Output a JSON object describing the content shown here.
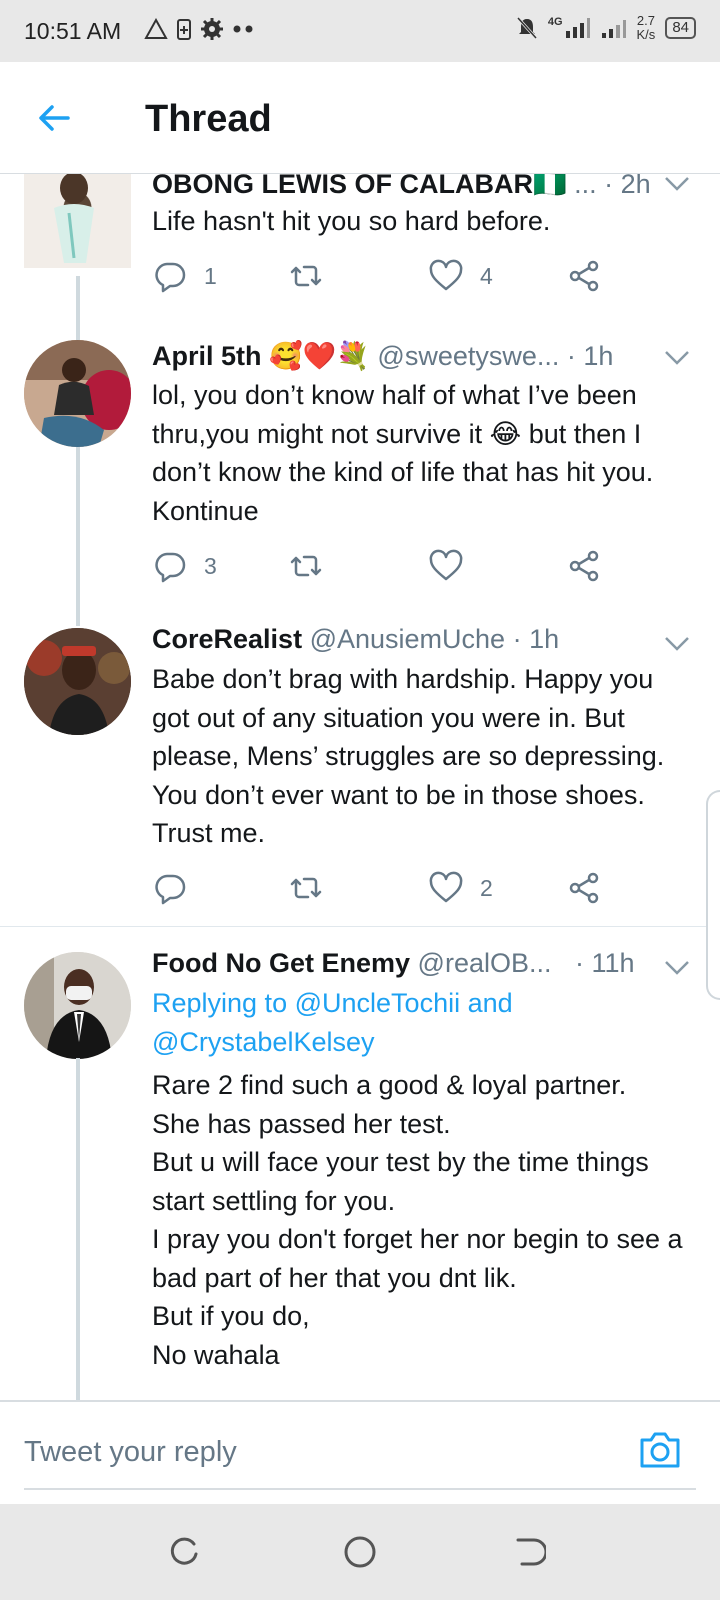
{
  "status_bar": {
    "time": "10:51 AM",
    "network": "4G",
    "speed_value": "2.7",
    "speed_unit": "K/s",
    "battery": "84",
    "icons": [
      "alert-triangle-icon",
      "battery-saver-icon",
      "settings-gear-icon",
      "more-dots-icon",
      "mute-bell-icon",
      "signal-icon",
      "signal-icon"
    ]
  },
  "header": {
    "title": "Thread",
    "back_icon": "back-arrow-icon"
  },
  "tweets": [
    {
      "name": "OBONG LEWIS OF CALABAR",
      "name_emoji": "🇳🇬",
      "handle": "...",
      "time": "· 2h",
      "body": "Life hasn't hit you so hard before.",
      "reply_count": "1",
      "retweet_count": "",
      "like_count": "4"
    },
    {
      "name": "April 5th",
      "name_emoji": "🥰❤️💐",
      "handle": "@sweetyswe...",
      "time": "· 1h",
      "body": "lol, you don’t know half of what I’ve been thru,you might not survive it 😂 but then I don’t know the kind of life that has hit you. Kontinue",
      "reply_count": "3",
      "retweet_count": "",
      "like_count": ""
    },
    {
      "name": "CoreRealist",
      "handle": "@AnusiemUche",
      "time": "· 1h",
      "body": "Babe don’t brag with hardship. Happy you got out of any situation you were in. But please, Mens’ struggles are so depressing. You don’t ever want to be in those shoes. Trust me.",
      "reply_count": "",
      "retweet_count": "",
      "like_count": "2"
    },
    {
      "name": "Food No Get Enemy",
      "handle": "@realOB...",
      "time": "· 11h",
      "replying_prefix": "Replying to",
      "replying_to": "@UncleTochii and @CrystabelKelsey",
      "body_lines": [
        "Rare 2 find such a good & loyal partner.",
        "She has passed her test.",
        "But u will face your test by the time things start settling for you.",
        "I pray you don't forget her nor begin to see a bad part of her that you dnt lik.",
        "But if you do,",
        "No wahala"
      ]
    }
  ],
  "reply_bar": {
    "placeholder": "Tweet your reply",
    "camera_icon": "camera-icon"
  },
  "colors": {
    "accent": "#1da1f2",
    "text": "#14171a",
    "muted": "#657786",
    "thread_line": "#cfd9de"
  }
}
